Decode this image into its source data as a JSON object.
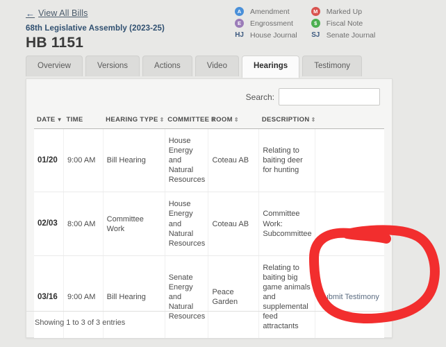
{
  "header": {
    "back_link": "View All Bills",
    "back_icon": "arrow-left-icon",
    "assembly": "68th Legislative Assembly (2023-25)",
    "bill_number": "HB 1151"
  },
  "legend": {
    "left": [
      {
        "badge": "A",
        "label": "Amendment",
        "color": "#4a90d9",
        "type": "circle"
      },
      {
        "badge": "E",
        "label": "Engrossment",
        "color": "#9b7cb8",
        "type": "circle"
      },
      {
        "badge": "HJ",
        "label": "House Journal",
        "color": "#3d5a80",
        "type": "text"
      }
    ],
    "right": [
      {
        "badge": "M",
        "label": "Marked Up",
        "color": "#d9534f",
        "type": "circle"
      },
      {
        "badge": "$",
        "label": "Fiscal Note",
        "color": "#4caf50",
        "type": "circle"
      },
      {
        "badge": "SJ",
        "label": "Senate Journal",
        "color": "#3d5a80",
        "type": "text"
      }
    ]
  },
  "tabs": [
    {
      "label": "Overview",
      "active": false
    },
    {
      "label": "Versions",
      "active": false
    },
    {
      "label": "Actions",
      "active": false
    },
    {
      "label": "Video",
      "active": false
    },
    {
      "label": "Hearings",
      "active": true
    },
    {
      "label": "Testimony",
      "active": false
    }
  ],
  "search": {
    "label": "Search:",
    "value": "",
    "placeholder": ""
  },
  "table": {
    "columns": [
      {
        "label": "DATE",
        "sort": "desc"
      },
      {
        "label": "TIME",
        "sort": "none"
      },
      {
        "label": "HEARING TYPE",
        "sort": "both"
      },
      {
        "label": "COMMITTEE",
        "sort": "both"
      },
      {
        "label": "ROOM",
        "sort": "both"
      },
      {
        "label": "DESCRIPTION",
        "sort": "both"
      },
      {
        "label": "",
        "sort": "none"
      }
    ],
    "rows": [
      {
        "date": "01/20",
        "time": "9:00 AM",
        "hearing_type": "Bill Hearing",
        "committee": "House Energy and Natural Resources",
        "room": "Coteau AB",
        "description": "Relating to baiting deer for hunting",
        "action": ""
      },
      {
        "date": "02/03",
        "time": "8:00 AM",
        "hearing_type": "Committee Work",
        "committee": "House Energy and Natural Resources",
        "room": "Coteau AB",
        "description": "Committee Work: Subcommittee",
        "action": ""
      },
      {
        "date": "03/16",
        "time": "9:00 AM",
        "hearing_type": "Bill Hearing",
        "committee": "Senate Energy and Natural Resources",
        "room": "Peace Garden",
        "description": "Relating to baiting big game animals and supplemental feed attractants",
        "action": "Submit Testimony"
      }
    ]
  },
  "footer": {
    "showing": "Showing 1 to 3 of 3 entries"
  },
  "annotation": {
    "shape": "hand-drawn-circle",
    "color": "#f22e2e",
    "target": "Submit Testimony"
  }
}
